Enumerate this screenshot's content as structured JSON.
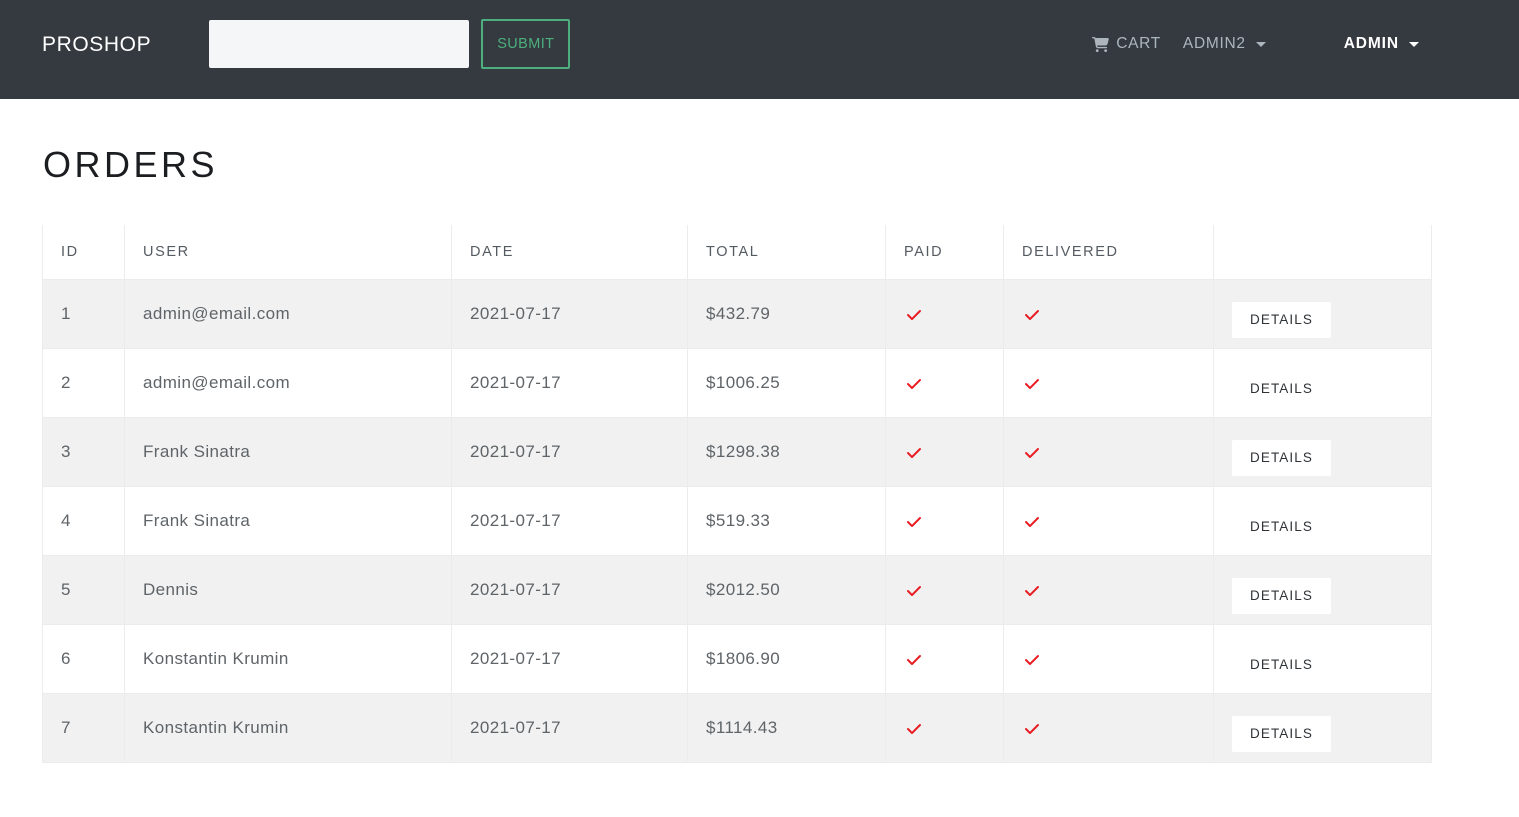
{
  "navbar": {
    "brand": "ProShop",
    "search": {
      "value": "",
      "placeholder": "",
      "submit_label": "Submit"
    },
    "links": [
      {
        "label": "Cart",
        "icon": "shopping-cart-icon",
        "has_caret": false
      },
      {
        "label": "ADMIN2",
        "icon": "chevron-down-icon",
        "has_caret": true
      },
      {
        "label": "ADMIN",
        "icon": "chevron-down-icon",
        "has_caret": true
      }
    ],
    "colors": {
      "background": "#343a40",
      "brand_text": "#ffffff",
      "link_muted": "#adb5bd",
      "link_active": "#ffffff",
      "submit_border": "#4caf7d",
      "submit_text": "#4caf7d"
    }
  },
  "page": {
    "title": "ORDERS"
  },
  "table": {
    "columns": [
      "ID",
      "USER",
      "DATE",
      "TOTAL",
      "PAID",
      "DELIVERED",
      ""
    ],
    "details_label": "DETAILS",
    "check_color": "#e81c23",
    "rows": [
      {
        "id": "1",
        "user": "admin@email.com",
        "date": "2021-07-17",
        "total": "$432.79",
        "paid": true,
        "delivered": true
      },
      {
        "id": "2",
        "user": "admin@email.com",
        "date": "2021-07-17",
        "total": "$1006.25",
        "paid": true,
        "delivered": true
      },
      {
        "id": "3",
        "user": "Frank Sinatra",
        "date": "2021-07-17",
        "total": "$1298.38",
        "paid": true,
        "delivered": true
      },
      {
        "id": "4",
        "user": "Frank Sinatra",
        "date": "2021-07-17",
        "total": "$519.33",
        "paid": true,
        "delivered": true
      },
      {
        "id": "5",
        "user": "Dennis",
        "date": "2021-07-17",
        "total": "$2012.50",
        "paid": true,
        "delivered": true
      },
      {
        "id": "6",
        "user": "Konstantin Krumin",
        "date": "2021-07-17",
        "total": "$1806.90",
        "paid": true,
        "delivered": true
      },
      {
        "id": "7",
        "user": "Konstantin Krumin",
        "date": "2021-07-17",
        "total": "$1114.43",
        "paid": true,
        "delivered": true
      }
    ]
  }
}
